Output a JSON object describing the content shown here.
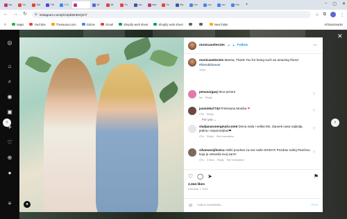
{
  "browser": {
    "tabs": [
      {
        "label": "Ins",
        "color": "#c13584"
      },
      {
        "label": "Co",
        "color": "#e94235"
      },
      {
        "label": "Sat",
        "color": "#e94235"
      },
      {
        "label": "TIK",
        "color": "#4f46e5"
      },
      {
        "label": "X G",
        "color": "#4285f4"
      },
      {
        "label": "",
        "color": "#c13584",
        "active": true
      },
      {
        "label": "Mi",
        "color": "#4f6ad8"
      },
      {
        "label": "Mi",
        "color": "#db4437"
      },
      {
        "label": "Yo",
        "color": "#e94235"
      },
      {
        "label": "mo",
        "color": "#3b5998"
      },
      {
        "label": "inst",
        "color": "#c13584"
      },
      {
        "label": "Yo",
        "color": "#e94235"
      },
      {
        "label": "Mo",
        "color": "#3b5998"
      },
      {
        "label": "mo",
        "color": "#4285f4"
      },
      {
        "label": "mo",
        "color": "#4285f4"
      },
      {
        "label": "mo",
        "color": "#4285f4"
      },
      {
        "label": "Kin",
        "color": "#4285f4"
      }
    ],
    "url": "instagram.com/p/CZpb9mEvQX7/",
    "bookmarks": [
      {
        "label": "Maps",
        "color": "#34a853"
      },
      {
        "label": "YouTube",
        "color": "#e94235"
      },
      {
        "label": "Thesaurus.com",
        "color": "#f4a300"
      },
      {
        "label": "Gdrive",
        "color": "#4285f4"
      },
      {
        "label": "Gmail",
        "color": "#db4437"
      },
      {
        "label": "Shopify work sheet",
        "color": "#0f9d58"
      },
      {
        "label": "Shopify work sheet",
        "color": "#0f9d58"
      },
      {
        "label": "",
        "color": "#5f6368"
      },
      {
        "label": "",
        "color": "#5f6368"
      },
      {
        "label": "New folder",
        "color": "#f9ab00"
      }
    ],
    "all_bookmarks": "All Bookmarks"
  },
  "post": {
    "username": "monicaseles10s",
    "follow_label": "Follow",
    "caption_user": "monicaseles10s",
    "caption_text": "Marina, Thank You for being such an amazing friend ",
    "caption_hashtag": "#friendsforever",
    "caption_age": "164w",
    "for_you": "For you ⌄",
    "comments": [
      {
        "user": "penavargasj",
        "text": "Nice picture",
        "age": "9w",
        "reply": "Reply",
        "likes": "",
        "see_translation": "",
        "avatar": "#e07aa8"
      },
      {
        "user": "jasminka7742",
        "text": "Prekrasna Monika ",
        "age": "27w",
        "reply": "Reply",
        "likes": "",
        "see_translation": "",
        "avatar": "#6b4b3e",
        "heart": "❤"
      },
      {
        "user": "sladjanaranergmail.com6",
        "text": "Divna mala i velika Mo. Zauvek nasa najbolja, jedina i neponovljiva!❤",
        "age": "47w",
        "reply": "Reply",
        "likes": "",
        "see_translation": "See translation",
        "avatar": "#e6e6e6"
      },
      {
        "user": "silvanavojilovica",
        "text": "Veliki pozdrav za sve naše DIVE!!!!! Pozdrav našoj Pančevu koja je ostvarila svoj san!!!",
        "age": "47w",
        "reply": "Reply",
        "likes": "3 likes",
        "see_translation": "See translation",
        "avatar": "#7a6a5e"
      }
    ],
    "likes": "2,344 likes",
    "date": "February 7, 2022",
    "add_comment_placeholder": "Add a comment...",
    "post_label": "Post"
  }
}
